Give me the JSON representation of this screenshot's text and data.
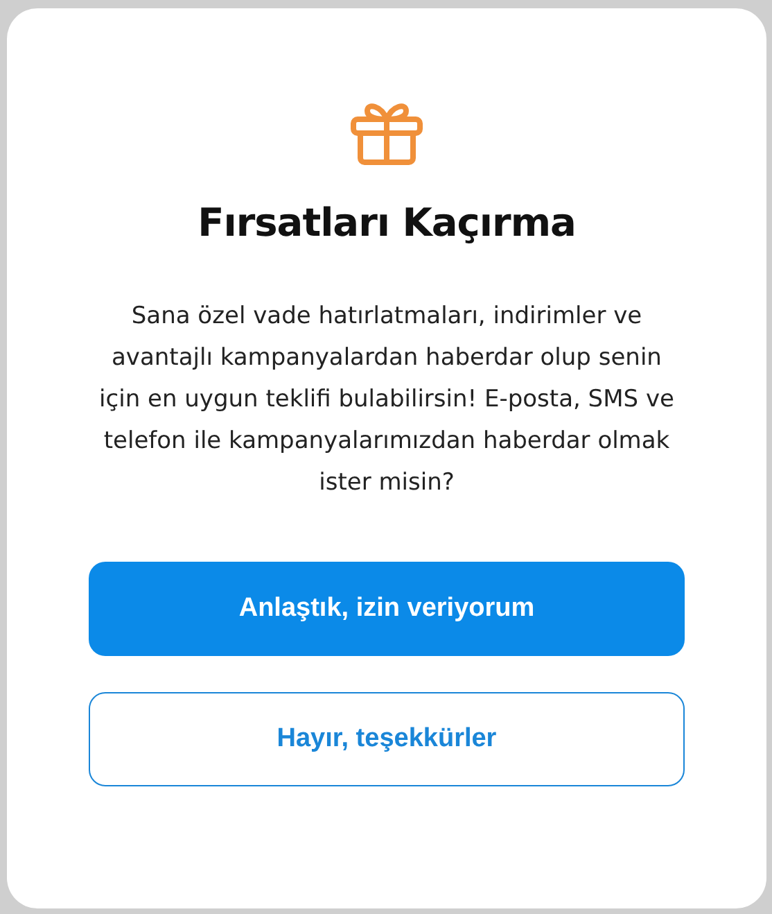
{
  "dialog": {
    "title": "Fırsatları Kaçırma",
    "message": "Sana özel vade hatırlatmaları, indirimler ve avantajlı kampanyalardan haberdar olup senin için en uygun teklifi bulabilirsin! E-posta, SMS ve telefon ile kampanyalarımızdan haberdar olmak ister misin?",
    "buttons": [
      {
        "label": "Anlaştık, izin veriyorum",
        "kind": "primary"
      },
      {
        "label": "Hayır, teşekkürler",
        "kind": "secondary"
      }
    ]
  }
}
